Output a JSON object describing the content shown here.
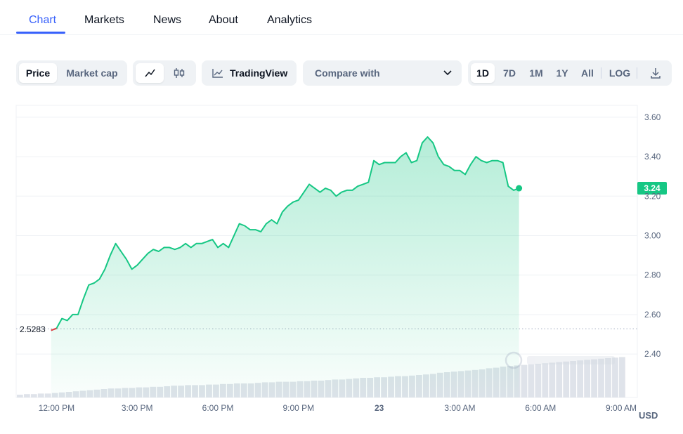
{
  "tabs": [
    "Chart",
    "Markets",
    "News",
    "About",
    "Analytics"
  ],
  "toolbar": {
    "price_label": "Price",
    "market_cap_label": "Market cap",
    "tradingview_label": "TradingView",
    "compare_label": "Compare with",
    "ranges": [
      "1D",
      "7D",
      "1M",
      "1Y",
      "All"
    ],
    "log_label": "LOG",
    "icons": {
      "line": "line-chart-icon",
      "candle": "candlestick-icon",
      "tv": "tradingview-icon",
      "chevron": "chevron-down-icon",
      "download": "download-icon"
    }
  },
  "colors": {
    "accent": "#3861fb",
    "up": "#16c784",
    "down": "#ea3943",
    "fill_top": "#c9f1df"
  },
  "chart_data": {
    "type": "area",
    "title": "",
    "xlabel": "",
    "ylabel": "",
    "currency_label": "USD",
    "ylim": [
      2.18,
      3.66
    ],
    "yticks": [
      2.4,
      2.6,
      2.8,
      3.0,
      3.2,
      3.4,
      3.6
    ],
    "ytick_labels": [
      "2.40",
      "2.60",
      "2.80",
      "3.00",
      "3.20",
      "3.40",
      "3.60"
    ],
    "xlim": [
      10.5,
      33.6
    ],
    "xticks": [
      12,
      15,
      18,
      21,
      24,
      27,
      30,
      33
    ],
    "xtick_labels": [
      "12:00 PM",
      "3:00 PM",
      "6:00 PM",
      "9:00 PM",
      "23",
      "3:00 AM",
      "6:00 AM",
      "9:00 AM"
    ],
    "open_price": 2.5283,
    "open_price_label": "2.5283",
    "last_price": 3.24,
    "last_price_label": "3.24",
    "x_hours": [
      11.8,
      12.0,
      12.2,
      12.4,
      12.6,
      12.8,
      13.0,
      13.2,
      13.4,
      13.6,
      13.8,
      14.0,
      14.2,
      14.4,
      14.6,
      14.8,
      15.0,
      15.2,
      15.4,
      15.6,
      15.8,
      16.0,
      16.2,
      16.4,
      16.6,
      16.8,
      17.0,
      17.2,
      17.4,
      17.6,
      17.8,
      18.0,
      18.2,
      18.4,
      18.6,
      18.8,
      19.0,
      19.2,
      19.4,
      19.6,
      19.8,
      20.0,
      20.2,
      20.4,
      20.6,
      20.8,
      21.0,
      21.2,
      21.4,
      21.6,
      21.8,
      22.0,
      22.2,
      22.4,
      22.6,
      22.8,
      23.0,
      23.2,
      23.4,
      23.6,
      23.8,
      24.0,
      24.2,
      24.4,
      24.6,
      24.8,
      25.0,
      25.2,
      25.4,
      25.6,
      25.8,
      26.0,
      26.2,
      26.4,
      26.6,
      26.8,
      27.0,
      27.2,
      27.4,
      27.6,
      27.8,
      28.0,
      28.2,
      28.4,
      28.6,
      28.8,
      29.0,
      29.2,
      29.4,
      29.6,
      29.8,
      30.0,
      30.2,
      30.4,
      30.6,
      30.8,
      31.0,
      31.2,
      31.4,
      31.6,
      31.8,
      32.0,
      32.2,
      32.4,
      32.6,
      32.8,
      33.0,
      33.2
    ],
    "prices": [
      2.52,
      2.53,
      2.58,
      2.57,
      2.6,
      2.6,
      2.68,
      2.75,
      2.76,
      2.78,
      2.83,
      2.9,
      2.96,
      2.92,
      2.88,
      2.83,
      2.85,
      2.88,
      2.91,
      2.93,
      2.92,
      2.94,
      2.94,
      2.93,
      2.94,
      2.96,
      2.94,
      2.96,
      2.96,
      2.97,
      2.98,
      2.94,
      2.96,
      2.94,
      3.0,
      3.06,
      3.05,
      3.03,
      3.03,
      3.02,
      3.06,
      3.08,
      3.06,
      3.12,
      3.15,
      3.17,
      3.18,
      3.22,
      3.26,
      3.24,
      3.22,
      3.24,
      3.23,
      3.2,
      3.22,
      3.23,
      3.23,
      3.25,
      3.26,
      3.27,
      3.38,
      3.36,
      3.37,
      3.37,
      3.37,
      3.4,
      3.42,
      3.37,
      3.38,
      3.47,
      3.5,
      3.47,
      3.4,
      3.36,
      3.35,
      3.33,
      3.33,
      3.31,
      3.36,
      3.4,
      3.38,
      3.37,
      3.38,
      3.38,
      3.37,
      3.25,
      3.23,
      3.24
    ],
    "volume": [
      0.05,
      0.06,
      0.06,
      0.07,
      0.07,
      0.08,
      0.09,
      0.1,
      0.11,
      0.12,
      0.13,
      0.14,
      0.15,
      0.16,
      0.16,
      0.17,
      0.17,
      0.18,
      0.18,
      0.19,
      0.19,
      0.2,
      0.21,
      0.21,
      0.22,
      0.22,
      0.22,
      0.23,
      0.23,
      0.24,
      0.24,
      0.25,
      0.25,
      0.25,
      0.26,
      0.27,
      0.27,
      0.28,
      0.28,
      0.28,
      0.29,
      0.29,
      0.3,
      0.3,
      0.31,
      0.32,
      0.32,
      0.33,
      0.34,
      0.35,
      0.35,
      0.36,
      0.36,
      0.37,
      0.38,
      0.38,
      0.39,
      0.4,
      0.41,
      0.42,
      0.44,
      0.45,
      0.46,
      0.47,
      0.48,
      0.49,
      0.5,
      0.52,
      0.53,
      0.55,
      0.56,
      0.57,
      0.58,
      0.59,
      0.6,
      0.61,
      0.62,
      0.63,
      0.64,
      0.65,
      0.66,
      0.67,
      0.68,
      0.69,
      0.7,
      0.71,
      0.72
    ]
  }
}
